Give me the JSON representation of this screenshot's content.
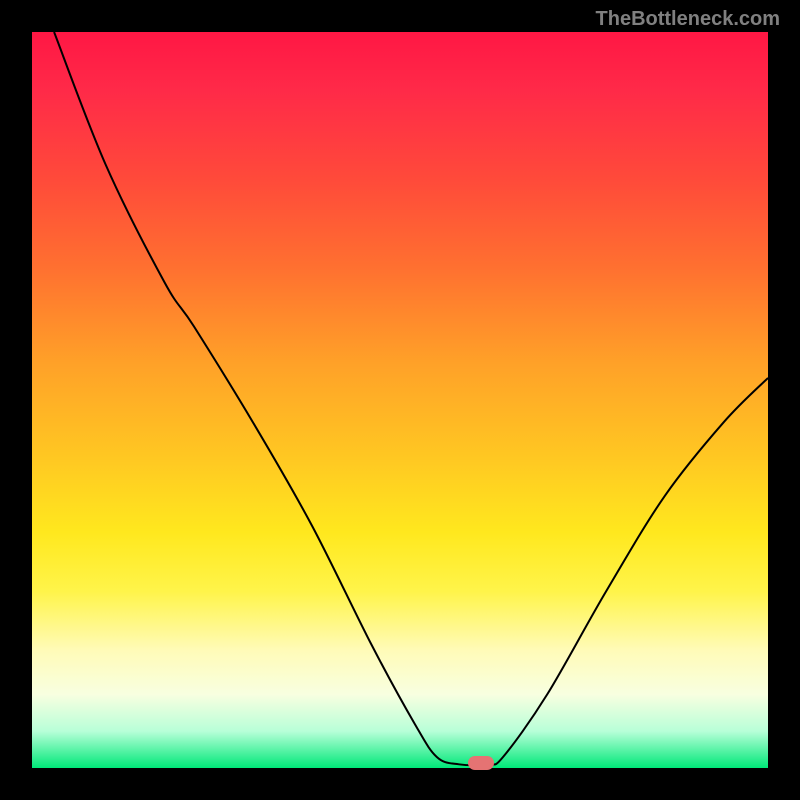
{
  "watermark": "TheBottleneck.com",
  "chart_data": {
    "type": "line",
    "title": "",
    "xlabel": "",
    "ylabel": "",
    "xlim": [
      0,
      100
    ],
    "ylim": [
      0,
      100
    ],
    "series": [
      {
        "name": "curve",
        "points": [
          {
            "x": 3,
            "y": 100
          },
          {
            "x": 10,
            "y": 82
          },
          {
            "x": 18,
            "y": 66
          },
          {
            "x": 22,
            "y": 60
          },
          {
            "x": 30,
            "y": 47
          },
          {
            "x": 38,
            "y": 33
          },
          {
            "x": 46,
            "y": 17
          },
          {
            "x": 52,
            "y": 6
          },
          {
            "x": 55,
            "y": 1.5
          },
          {
            "x": 58,
            "y": 0.5
          },
          {
            "x": 62,
            "y": 0.5
          },
          {
            "x": 64,
            "y": 1.5
          },
          {
            "x": 70,
            "y": 10
          },
          {
            "x": 78,
            "y": 24
          },
          {
            "x": 86,
            "y": 37
          },
          {
            "x": 94,
            "y": 47
          },
          {
            "x": 100,
            "y": 53
          }
        ]
      }
    ],
    "marker": {
      "x": 61,
      "y": 0.7
    },
    "gradient_colors": {
      "top": "#ff1744",
      "mid": "#ffe81e",
      "bottom": "#00e878"
    }
  }
}
